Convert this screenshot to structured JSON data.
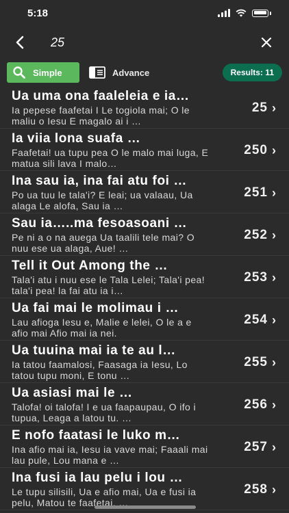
{
  "status": {
    "time": "5:18"
  },
  "search": {
    "value": "25"
  },
  "filters": {
    "simple_label": "Simple",
    "advance_label": "Advance",
    "results_label": "Results: 11"
  },
  "items": [
    {
      "title": "Ua uma ona faaleleia e ia…",
      "preview": "Ia pepese faafetai I Le togiola mai; O le maliu o Iesu E magalo ai i …",
      "number": "25"
    },
    {
      "title": "Ia viia lona suafa …",
      "preview": "Faafetai! ua tupu pea O le malo mai luga, E matua sili lava I malo…",
      "number": "250"
    },
    {
      "title": "Ina sau ia, ina fai atu foi …",
      "preview": "Po ua tuu le tala'i? E leai; ua valaau, Ua alaga Le alofa, Sau ia …",
      "number": "251"
    },
    {
      "title": "Sau ia…..ma fesoasoani …",
      "preview": "Pe ni a o na auega Ua taalili tele mai? O nuu ese ua alaga, Aue! …",
      "number": "252"
    },
    {
      "title": "Tell it Out Among the …",
      "preview": "Tala'i atu i nuu ese le Tala Lelei; Tala'i pea! tala'i pea! la fai atu ia i…",
      "number": "253"
    },
    {
      "title": "Ua fai mai le molimau i …",
      "preview": "Lau afioga Iesu e, Malie e lelei, O le a e afio mai Afio mai ia nei.",
      "number": "254"
    },
    {
      "title": "Ua tuuina mai ia te au l…",
      "preview": "Ia tatou faamalosi, Faasaga ia Iesu, Lo tatou tupu moni, E tonu …",
      "number": "255"
    },
    {
      "title": "Ua asiasi mai le …",
      "preview": "Talofa! oi talofa! I e ua faapaupau, O ifo i tupua, Leaga a latou tu. …",
      "number": "256"
    },
    {
      "title": "E nofo faatasi le luko m…",
      "preview": "Ina afio mai ia, Iesu ia vave mai; Faaali mai lau pule, Lou mana e …",
      "number": "257"
    },
    {
      "title": "Ina fusi ia lau pelu i lou …",
      "preview": "Le tupu silisili, Ua e afio mai, Ua e fusi ia pelu, Matou te faafetai. …",
      "number": "258"
    }
  ]
}
